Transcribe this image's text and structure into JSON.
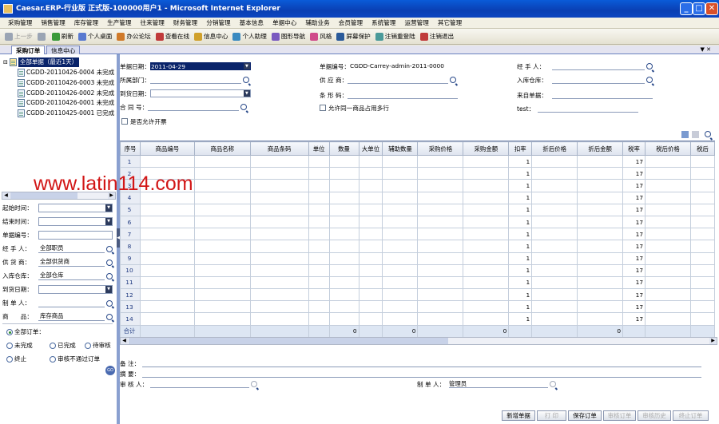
{
  "window": {
    "title": "Caesar.ERP-行业版 正式版-100000用户1 - Microsoft Internet Explorer",
    "buttons": {
      "minimize": "_",
      "maximize": "□",
      "close": "✕"
    }
  },
  "menu": [
    "采购管理",
    "销售管理",
    "库存管理",
    "生产管理",
    "往来管理",
    "财务管理",
    "分销管理",
    "基本信息",
    "单据中心",
    "辅助业务",
    "会员管理",
    "系统管理",
    "运营管理",
    "其它管理"
  ],
  "toolbar": [
    {
      "label": "上一步",
      "icon": "back-icon",
      "disabled": true
    },
    {
      "label": "",
      "icon": "forward-icon",
      "disabled": true
    },
    {
      "label": "刷新",
      "icon": "refresh-icon",
      "disabled": false
    },
    {
      "label": "个人桌面",
      "icon": "desktop-icon",
      "disabled": false
    },
    {
      "label": "办公论坛",
      "icon": "forum-icon",
      "disabled": false
    },
    {
      "label": "查看在线",
      "icon": "online-icon",
      "disabled": false
    },
    {
      "label": "信息中心",
      "icon": "message-icon",
      "disabled": false
    },
    {
      "label": "个人助理",
      "icon": "assistant-icon",
      "disabled": false
    },
    {
      "label": "图形导航",
      "icon": "navigation-icon",
      "disabled": false
    },
    {
      "label": "风格",
      "icon": "style-icon",
      "disabled": false
    },
    {
      "label": "屏幕保护",
      "icon": "screensaver-icon",
      "disabled": false
    },
    {
      "label": "注销重登陆",
      "icon": "relogin-icon",
      "disabled": false
    },
    {
      "label": "注销退出",
      "icon": "logout-icon",
      "disabled": false
    }
  ],
  "tabs": [
    {
      "label": "采购订单",
      "active": true
    },
    {
      "label": "信息中心",
      "active": false
    }
  ],
  "tabs_collapse": "▼ ✕",
  "tree": {
    "root": "全部单据（最近1天）",
    "items": [
      "CGDD-20110426-0004 未完成",
      "CGDD-20110426-0003 未完成",
      "CGDD-20110426-0002 未完成",
      "CGDD-20110426-0001 未完成",
      "CGDD-20110425-0001 已完成"
    ]
  },
  "filter": {
    "start_time_label": "起始时间：",
    "end_time_label": "结束时间：",
    "doc_no_label": "单据编号：",
    "handler_label": "经 手 人：",
    "handler_value": "全部职员",
    "supplier_label": "供 货 商：",
    "supplier_value": "全部供货商",
    "warehouse_label": "入库仓库：",
    "warehouse_value": "全部仓库",
    "arrival_label": "到货日期：",
    "maker_label": "制 单 人：",
    "goods_label": "商　　品：",
    "goods_value": "库存商品",
    "status_options": [
      "全部订单：",
      "未完成",
      "已完成",
      "待审核",
      "终止",
      "审核不通过订单"
    ],
    "status_selected": 0,
    "go_button": "GO"
  },
  "header_form": {
    "doc_date_label": "单据日期：",
    "doc_date_value": "2011-04-29",
    "dept_label": "所属部门：",
    "arrival_date_label": "到货日期：",
    "contract_label": "合 同 号：",
    "allow_invoice_label": "是否允许开票",
    "doc_no_label": "单据编号：",
    "doc_no_value": "CGDD-Carrey-admin-2011-0000",
    "supplier_label": "供 应 商：",
    "barcode_label": "条 形 码：",
    "same_goods_label": "允许同一商品占用多行",
    "handler_label": "经 手 人：",
    "warehouse_label": "入库仓库：",
    "source_label": "来自单据：",
    "test_label": "test："
  },
  "grid": {
    "columns": [
      "序号",
      "商品编号",
      "商品名称",
      "商品条码",
      "单位",
      "数量",
      "大单位",
      "辅助数量",
      "采购价格",
      "采购金额",
      "扣率",
      "折后价格",
      "折后金额",
      "税率",
      "税后价格",
      "税后"
    ],
    "rows": [
      {
        "no": "1",
        "rate": "1",
        "tax": "17"
      },
      {
        "no": "2",
        "rate": "1",
        "tax": "17"
      },
      {
        "no": "3",
        "rate": "1",
        "tax": "17"
      },
      {
        "no": "4",
        "rate": "1",
        "tax": "17"
      },
      {
        "no": "5",
        "rate": "1",
        "tax": "17"
      },
      {
        "no": "6",
        "rate": "1",
        "tax": "17"
      },
      {
        "no": "7",
        "rate": "1",
        "tax": "17"
      },
      {
        "no": "8",
        "rate": "1",
        "tax": "17"
      },
      {
        "no": "9",
        "rate": "1",
        "tax": "17"
      },
      {
        "no": "10",
        "rate": "1",
        "tax": "17"
      },
      {
        "no": "11",
        "rate": "1",
        "tax": "17"
      },
      {
        "no": "12",
        "rate": "1",
        "tax": "17"
      },
      {
        "no": "13",
        "rate": "1",
        "tax": "17"
      },
      {
        "no": "14",
        "rate": "1",
        "tax": "17"
      }
    ],
    "summary": {
      "label": "合计",
      "qty": "0",
      "aux_qty": "0",
      "amount": "0",
      "disc_amount": "0"
    }
  },
  "footer": {
    "remark_label": "备 注：",
    "summary_label": "摘 要：",
    "auditor_label": "审 核 人：",
    "maker_label": "制 单 人：",
    "maker_value": "管理员"
  },
  "actions": [
    {
      "label": "新增单据",
      "disabled": false
    },
    {
      "label": "打 印",
      "disabled": true
    },
    {
      "label": "保存订单",
      "disabled": false
    },
    {
      "label": "审核订单",
      "disabled": true
    },
    {
      "label": "审核历史",
      "disabled": true
    },
    {
      "label": "终止订单",
      "disabled": true
    }
  ],
  "watermark": "www.latin114.com",
  "colors": {
    "titlebar": "#0a4cc8",
    "selected": "#0a246a",
    "watermark": "#d21616"
  }
}
